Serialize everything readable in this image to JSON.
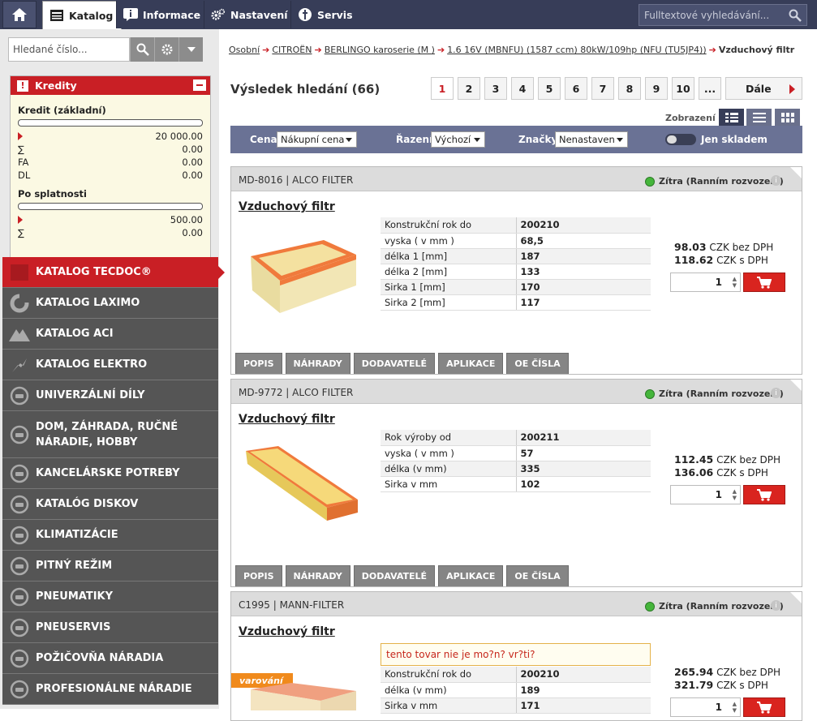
{
  "nav": {
    "tabs": [
      {
        "label": "Katalog"
      },
      {
        "label": "Informace"
      },
      {
        "label": "Nastavení"
      },
      {
        "label": "Servis"
      }
    ],
    "search_placeholder": "Fulltextové vyhledávání..."
  },
  "left": {
    "number_search_placeholder": "Hledané číslo...",
    "credits": {
      "title": "Kredity",
      "basic_label": "Kredit (základní)",
      "basic_value": "20 000.00",
      "rows": [
        {
          "label": "∑",
          "value": "0.00"
        },
        {
          "label": "FA",
          "value": "0.00"
        },
        {
          "label": "DL",
          "value": "0.00"
        }
      ],
      "due_label": "Po splatnosti",
      "due_value": "500.00",
      "due_sum_label": "∑",
      "due_sum_value": "0.00"
    },
    "menu": [
      {
        "label": "KATALOG TECDOC®"
      },
      {
        "label": "KATALOG LAXIMO"
      },
      {
        "label": "KATALOG ACI"
      },
      {
        "label": "KATALOG ELEKTRO"
      },
      {
        "label": "UNIVERZÁLNÍ DÍLY"
      },
      {
        "label": "DOM, ZÁHRADA, RUČNÉ NÁRADIE, HOBBY"
      },
      {
        "label": "KANCELÁRSKE POTREBY"
      },
      {
        "label": "KATALÓG DISKOV"
      },
      {
        "label": "KLIMATIZÁCIE"
      },
      {
        "label": "PITNÝ REŽIM"
      },
      {
        "label": "PNEUMATIKY"
      },
      {
        "label": "PNEUSERVIS"
      },
      {
        "label": "POŽIČOVŇA NÁRADIA"
      },
      {
        "label": "PROFESIONÁLNE NÁRADIE"
      }
    ]
  },
  "breadcrumb": {
    "items": [
      "Osobní",
      "CITROËN",
      "BERLINGO karoserie (M )",
      "1.6 16V (MBNFU) (1587 ccm) 80kW/109hp (NFU (TU5JP4))"
    ],
    "current": "Vzduchový filtr"
  },
  "results": {
    "title": "Výsledek hledání (66)",
    "pages": [
      "1",
      "2",
      "3",
      "4",
      "5",
      "6",
      "7",
      "8",
      "9",
      "10",
      "..."
    ],
    "next": "Dále",
    "view_label": "Zobrazení"
  },
  "filters": {
    "price_label": "Cena",
    "price_value": "Nákupní cena",
    "sort_label": "Řazení",
    "sort_value": "Výchozí",
    "brand_label": "Značky",
    "brand_value": "Nenastaven",
    "stock_label": "Jen skladem"
  },
  "products": [
    {
      "code": "MD-8016 | ALCO FILTER",
      "availability": "Zítra (Ranním rozvozem)",
      "title": "Vzduchový filtr",
      "specs": [
        [
          "Konstrukční rok do",
          "200210"
        ],
        [
          "vyska ( v mm )",
          "68,5"
        ],
        [
          "délka 1 [mm]",
          "187"
        ],
        [
          "délka 2 [mm]",
          "133"
        ],
        [
          "Sirka 1 [mm]",
          "170"
        ],
        [
          "Sirka 2 [mm]",
          "117"
        ]
      ],
      "price_net": "98.03",
      "price_net_unit": "CZK bez DPH",
      "price_gross": "118.62",
      "price_gross_unit": "CZK s DPH",
      "qty": "1"
    },
    {
      "code": "MD-9772 | ALCO FILTER",
      "availability": "Zítra (Ranním rozvozem)",
      "title": "Vzduchový filtr",
      "specs": [
        [
          "Rok výroby od",
          "200211"
        ],
        [
          "vyska ( v mm )",
          "57"
        ],
        [
          "délka (v mm)",
          "335"
        ],
        [
          "Sirka v mm",
          "102"
        ]
      ],
      "price_net": "112.45",
      "price_net_unit": "CZK bez DPH",
      "price_gross": "136.06",
      "price_gross_unit": "CZK s DPH",
      "qty": "1"
    },
    {
      "code": "C1995 | MANN-FILTER",
      "availability": "Zítra (Ranním rozvozem)",
      "title": "Vzduchový filtr",
      "warning_badge": "varování",
      "warning_text": "tento tovar nie je mo?n? vr?ti?",
      "specs": [
        [
          "Konstrukční rok do",
          "200210"
        ],
        [
          "délka (v mm)",
          "189"
        ],
        [
          "Sirka v mm",
          "171"
        ]
      ],
      "price_net": "265.94",
      "price_net_unit": "CZK bez DPH",
      "price_gross": "321.79",
      "price_gross_unit": "CZK s DPH",
      "qty": "1"
    }
  ],
  "product_tabs": [
    "POPIS",
    "NÁHRADY",
    "DODAVATELÉ",
    "APLIKACE",
    "OE ČÍSLA"
  ],
  "colors": {
    "nav": "#373d58",
    "accent": "#c91f25",
    "filterbar": "#6a7295",
    "sidebar": "#555555",
    "available": "#45b53b"
  }
}
